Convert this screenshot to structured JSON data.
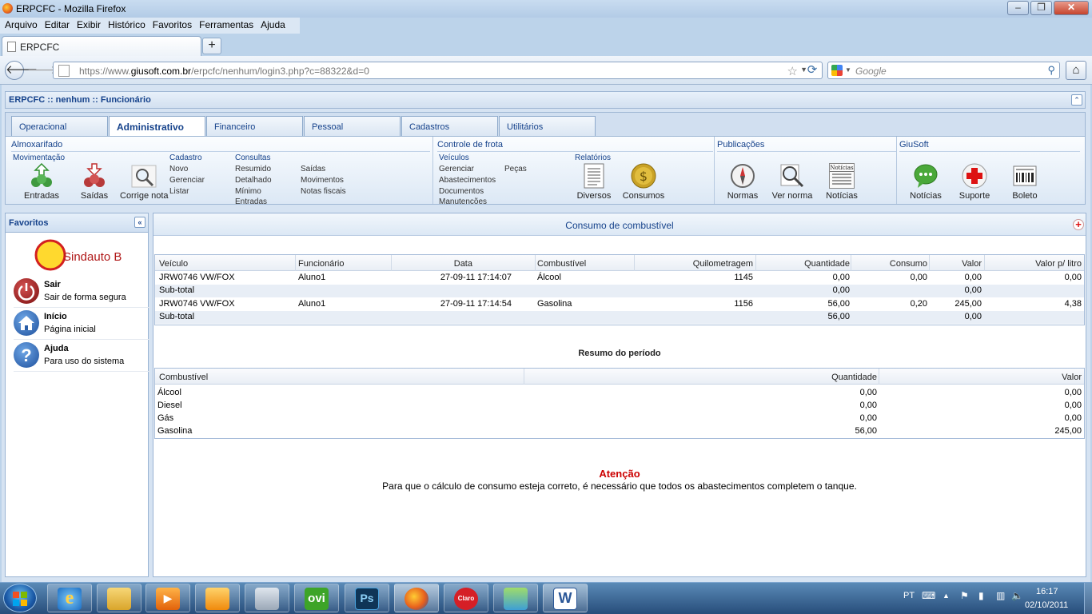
{
  "window": {
    "title": "ERPCFC - Mozilla Firefox"
  },
  "menu": [
    "Arquivo",
    "Editar",
    "Exibir",
    "Histórico",
    "Favoritos",
    "Ferramentas",
    "Ajuda"
  ],
  "browser_tab": {
    "title": "ERPCFC",
    "new_tab": "+"
  },
  "address": {
    "prefix": "https://www.",
    "domain": "giusoft.com.br",
    "path": "/erpcfc/nenhum/login3.php?c=88322&d=0"
  },
  "search": {
    "placeholder": "Google"
  },
  "app": {
    "title": "ERPCFC :: nenhum :: Funcionário"
  },
  "tabs": [
    "Operacional",
    "Administrativo",
    "Financeiro",
    "Pessoal",
    "Cadastros",
    "Utilitários"
  ],
  "ribbon": {
    "almox": {
      "title": "Almoxarifado",
      "mov": "Movimentação",
      "entradas": "Entradas",
      "saidas": "Saídas",
      "corrige": "Corrige nota",
      "cadastro": "Cadastro",
      "novo": "Novo",
      "gerenciar": "Gerenciar",
      "listar": "Listar",
      "consultas": "Consultas",
      "resumido": "Resumido",
      "detalhado": "Detalhado",
      "minimo": "Mínimo",
      "entradas2": "Entradas",
      "c_saidas": "Saídas",
      "movimentos": "Movimentos",
      "notas": "Notas fiscais"
    },
    "frota": {
      "title": "Controle de frota",
      "veiculos": "Veículos",
      "gerenciar": "Gerenciar",
      "abastecimentos": "Abastecimentos",
      "documentos": "Documentos",
      "manutencoes": "Manutenções",
      "pecas": "Peças",
      "relatorios": "Relatórios",
      "diversos": "Diversos",
      "consumos": "Consumos"
    },
    "pub": {
      "title": "Publicações",
      "normas": "Normas",
      "ver_norma": "Ver norma",
      "noticias": "Notícias",
      "noticias_icon_text": "Notícias"
    },
    "giusoft": {
      "title": "GiuSoft",
      "noticias": "Notícias",
      "suporte": "Suporte",
      "boleto": "Boleto"
    }
  },
  "favoritos": {
    "title": "Favoritos",
    "logo_text": "Sindauto Ba",
    "items": [
      {
        "title": "Sair",
        "sub": "Sair de forma segura"
      },
      {
        "title": "Início",
        "sub": "Página inicial"
      },
      {
        "title": "Ajuda",
        "sub": "Para uso do sistema"
      }
    ]
  },
  "main": {
    "title": "Consumo de combustível",
    "table": {
      "headers": [
        "Veículo",
        "Funcionário",
        "Data",
        "Combustível",
        "Quilometragem",
        "Quantidade",
        "Consumo",
        "Valor",
        "Valor p/ litro"
      ],
      "rows": [
        [
          "JRW0746 VW/FOX",
          "Aluno1",
          "27-09-11 17:14:07",
          "Álcool",
          "1145",
          "0,00",
          "0,00",
          "0,00",
          "0,00"
        ],
        [
          "Sub-total",
          "",
          "",
          "",
          "",
          "0,00",
          "",
          "0,00",
          ""
        ],
        [
          "JRW0746 VW/FOX",
          "Aluno1",
          "27-09-11 17:14:54",
          "Gasolina",
          "1156",
          "56,00",
          "0,20",
          "245,00",
          "4,38"
        ],
        [
          "Sub-total",
          "",
          "",
          "",
          "",
          "56,00",
          "",
          "0,00",
          ""
        ]
      ]
    },
    "resumo": {
      "title": "Resumo do período",
      "headers": [
        "Combustível",
        "Quantidade",
        "Valor"
      ],
      "rows": [
        [
          "Álcool",
          "0,00",
          "0,00"
        ],
        [
          "Diesel",
          "0,00",
          "0,00"
        ],
        [
          "Gás",
          "0,00",
          "0,00"
        ],
        [
          "Gasolina",
          "56,00",
          "245,00"
        ]
      ]
    },
    "atencao": {
      "title": "Atenção",
      "text": "Para que o cálculo de consumo esteja correto, é necessário que todos os abastecimentos completem o tanque."
    }
  },
  "taskbar": {
    "lang": "PT",
    "time": "16:17",
    "date": "02/10/2011",
    "ovi": "ovi",
    "ps": "Ps",
    "claro": "Claro",
    "word": "W"
  },
  "colors": {
    "accent": "#15428b",
    "attention": "#cc0000"
  }
}
